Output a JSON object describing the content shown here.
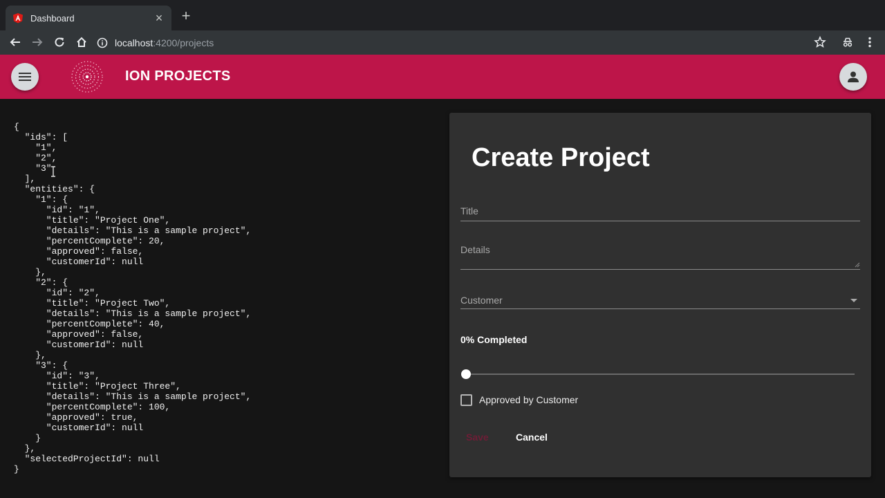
{
  "browser": {
    "tab_title": "Dashboard",
    "url_host": "localhost",
    "url_path": ":4200/projects",
    "favicon_icon": "angular-icon",
    "new_tab_glyph": "+",
    "close_glyph": "×"
  },
  "app": {
    "title": "ION PROJECTS",
    "brand_color": "#bd1549",
    "menu_icon": "hamburger-menu-icon",
    "user_icon": "user-account-icon"
  },
  "state_json": "{\n  \"ids\": [\n    \"1\",\n    \"2\",\n    \"3\"\n  ],\n  \"entities\": {\n    \"1\": {\n      \"id\": \"1\",\n      \"title\": \"Project One\",\n      \"details\": \"This is a sample project\",\n      \"percentComplete\": 20,\n      \"approved\": false,\n      \"customerId\": null\n    },\n    \"2\": {\n      \"id\": \"2\",\n      \"title\": \"Project Two\",\n      \"details\": \"This is a sample project\",\n      \"percentComplete\": 40,\n      \"approved\": false,\n      \"customerId\": null\n    },\n    \"3\": {\n      \"id\": \"3\",\n      \"title\": \"Project Three\",\n      \"details\": \"This is a sample project\",\n      \"percentComplete\": 100,\n      \"approved\": true,\n      \"customerId\": null\n    }\n  },\n  \"selectedProjectId\": null\n}",
  "form": {
    "heading": "Create Project",
    "title_label": "Title",
    "details_label": "Details",
    "customer_label": "Customer",
    "progress_label": "0% Completed",
    "progress_value": 0,
    "approved_label": "Approved by Customer",
    "approved_checked": false,
    "save_label": "Save",
    "cancel_label": "Cancel"
  }
}
